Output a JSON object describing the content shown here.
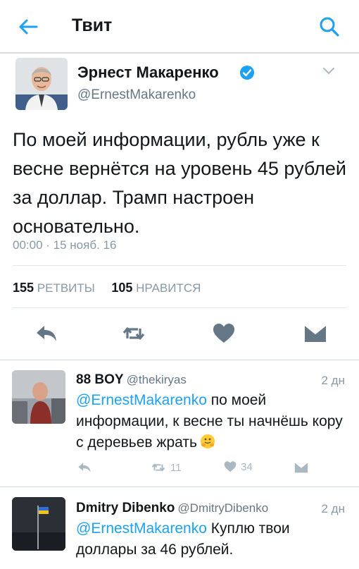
{
  "header": {
    "title": "Твит",
    "back_icon": "arrow-left-icon",
    "search_icon": "search-icon",
    "accent": "#1da1f2"
  },
  "tweet": {
    "author_name": "Эрнест Макаренко",
    "author_handle": "@ErnestMakarenko",
    "verified": true,
    "text": "По моей информации, рубль уже к весне вернётся на уровень 45 рублей за доллар. Трамп настроен основательно.",
    "timestamp": "00:00 · 15 нояб. 16",
    "retweets_count": "155",
    "retweets_label": "РЕТВИТЫ",
    "likes_count": "105",
    "likes_label": "НРАВИТСЯ"
  },
  "replies": [
    {
      "name": "88 BOY",
      "handle": "@thekiryas",
      "age": "2 дн",
      "mention": "@ErnestMakarenko",
      "text": " по моей информации, к весне ты начнёшь кору с деревьев жрать",
      "emoji": "hugging-face-emoji",
      "retweets": "11",
      "likes": "34"
    },
    {
      "name": "Dmitry Dibenko",
      "handle": "@DmitryDibenko",
      "age": "2 дн",
      "mention": "@ErnestMakarenko",
      "text": " Куплю твои доллары за 46 рублей."
    }
  ]
}
